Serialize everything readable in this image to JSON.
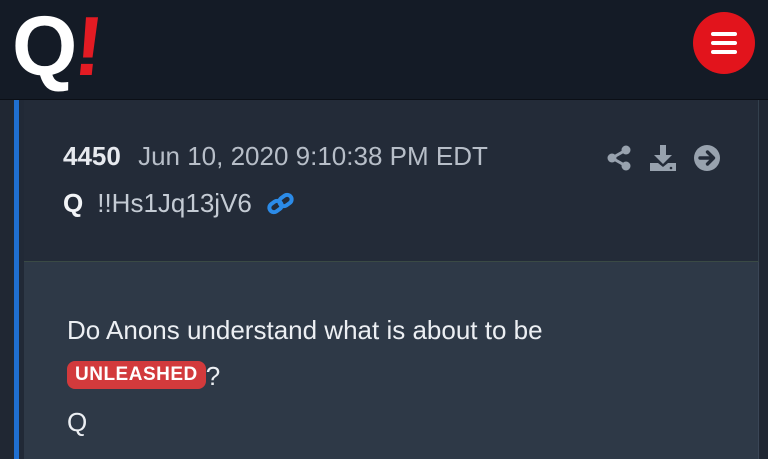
{
  "header": {
    "logo_letter": "Q",
    "logo_mark": "!",
    "menu_icon": "hamburger-menu-icon"
  },
  "post": {
    "number": "4450",
    "timestamp": "Jun 10, 2020 9:10:38 PM EDT",
    "author": "Q",
    "tripcode": "!!Hs1Jq13jV6",
    "icons": {
      "link": "link-icon",
      "share": "share-icon",
      "download": "download-icon",
      "go": "arrow-circle-right-icon"
    },
    "message": {
      "line1": "Do Anons understand what is about to be",
      "highlight": "UNLEASHED",
      "after_highlight": "?",
      "signature": "Q"
    }
  },
  "colors": {
    "topbar_bg": "#141b26",
    "page_bg": "#202733",
    "accent_red": "#e2141c",
    "accent_blue": "#1f6fd1",
    "link_blue": "#2b8be8",
    "highlight_bg": "#d23a3c"
  }
}
